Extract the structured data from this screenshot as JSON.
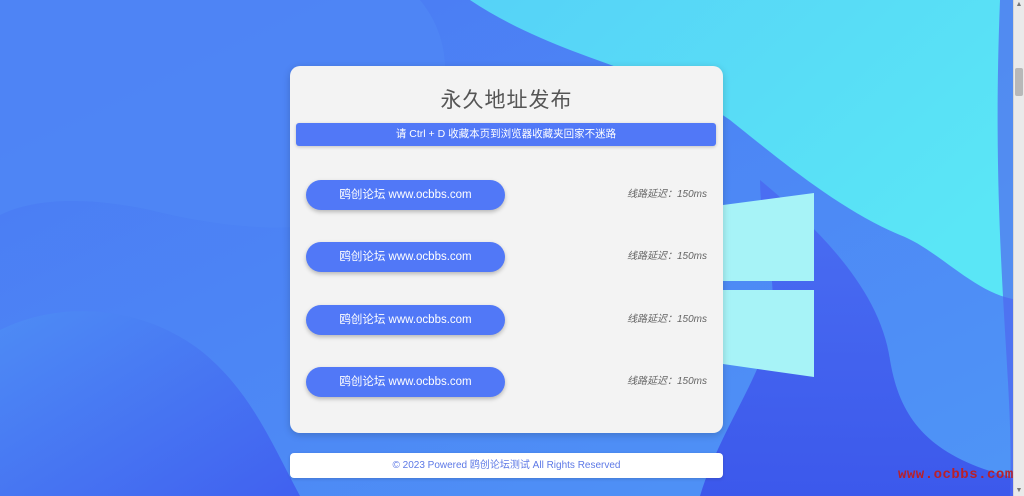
{
  "page": {
    "title": "永久地址发布",
    "notice": "请 Ctrl + D 收藏本页到浏览器收藏夹回家不迷路"
  },
  "links": [
    {
      "label": "鸥创论坛 www.ocbbs.com",
      "latency": "线路延迟：150ms"
    },
    {
      "label": "鸥创论坛 www.ocbbs.com",
      "latency": "线路延迟：150ms"
    },
    {
      "label": "鸥创论坛 www.ocbbs.com",
      "latency": "线路延迟：150ms"
    },
    {
      "label": "鸥创论坛 www.ocbbs.com",
      "latency": "线路延迟：150ms"
    }
  ],
  "footer": {
    "text": "© 2023 Powered 鸥创论坛测试 All Rights Reserved"
  },
  "watermark": "www.ocbbs.com",
  "colors": {
    "accent": "#5178f7",
    "card_bg": "#f3f3f3",
    "footer_text": "#5d79e6",
    "watermark": "#b8202a"
  },
  "icons": {
    "windows_logo": "windows-logo-icon",
    "scroll_up": "chevron-up-icon",
    "scroll_down": "chevron-down-icon"
  }
}
